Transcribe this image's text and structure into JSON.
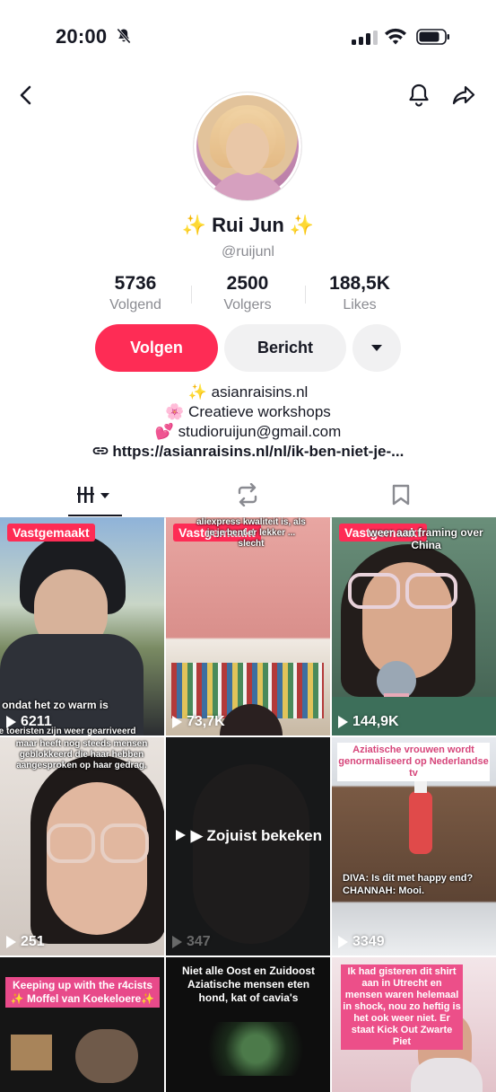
{
  "status_bar": {
    "time": "20:00"
  },
  "profile": {
    "name": "✨ Rui Jun ✨",
    "handle": "@ruijunl",
    "stats": [
      {
        "value": "5736",
        "label": "Volgend"
      },
      {
        "value": "2500",
        "label": "Volgers"
      },
      {
        "value": "188,5K",
        "label": "Likes"
      }
    ],
    "buttons": {
      "follow": "Volgen",
      "message": "Bericht"
    },
    "bio": [
      "✨ asianraisins.nl",
      "🌸 Creatieve workshops",
      "💕 studioruijun@gmail.com"
    ],
    "link": "https://asianraisins.nl/nl/ik-ben-niet-je-..."
  },
  "videos": [
    {
      "pinned": "Vastgemaakt",
      "views": "6211",
      "overlay_top": "",
      "overlay_bottom": "ondat het zo warm is",
      "overlay_bottom2": "De toeristen zijn weer gearriveerd"
    },
    {
      "pinned": "Vastgemaakt",
      "views": "73,7K",
      "overlay_top": "aliexpress kwaliteit is, als je je bent er lekker ... slecht",
      "overlay_bottom": "",
      "overlay_bottom2": ""
    },
    {
      "pinned": "Vastgemaakt",
      "views": "144,9K",
      "overlay_top": "weer aan framing over China",
      "overlay_bottom": "",
      "overlay_bottom2": ""
    },
    {
      "pinned": "",
      "views": "251",
      "overlay_top": "maar heeft nog steeds mensen geblokkeerd die haar hebben aangesproken op haar gedrag.",
      "overlay_bottom": "",
      "overlay_bottom2": ""
    },
    {
      "pinned": "",
      "views": "347",
      "watched": "▶ Zojuist bekeken",
      "overlay_top": "",
      "overlay_bottom": "",
      "overlay_bottom2": ""
    },
    {
      "pinned": "",
      "views": "3349",
      "overlay_top": "Aziatische vrouwen wordt genormaliseerd op Nederlandse tv",
      "overlay_bottom": "DIVA: Is dit met happy end?",
      "overlay_bottom2": "CHANNAH: Mooi."
    },
    {
      "pinned": "",
      "views": "",
      "overlay_top": "Keeping up with the r4cists ✨ Moffel van Koekeloere✨",
      "overlay_bottom": "",
      "overlay_bottom2": ""
    },
    {
      "pinned": "",
      "views": "",
      "overlay_top": "Niet alle Oost en Zuidoost Aziatische mensen eten hond, kat of cavia's",
      "overlay_bottom": "",
      "overlay_bottom2": ""
    },
    {
      "pinned": "",
      "views": "",
      "overlay_top": "Ik had gisteren dit shirt aan in Utrecht en mensen waren helemaal in shock, nou zo heftig is het ook weer niet. Er staat Kick Out Zwarte Piet",
      "overlay_bottom": "",
      "overlay_bottom2": ""
    }
  ]
}
